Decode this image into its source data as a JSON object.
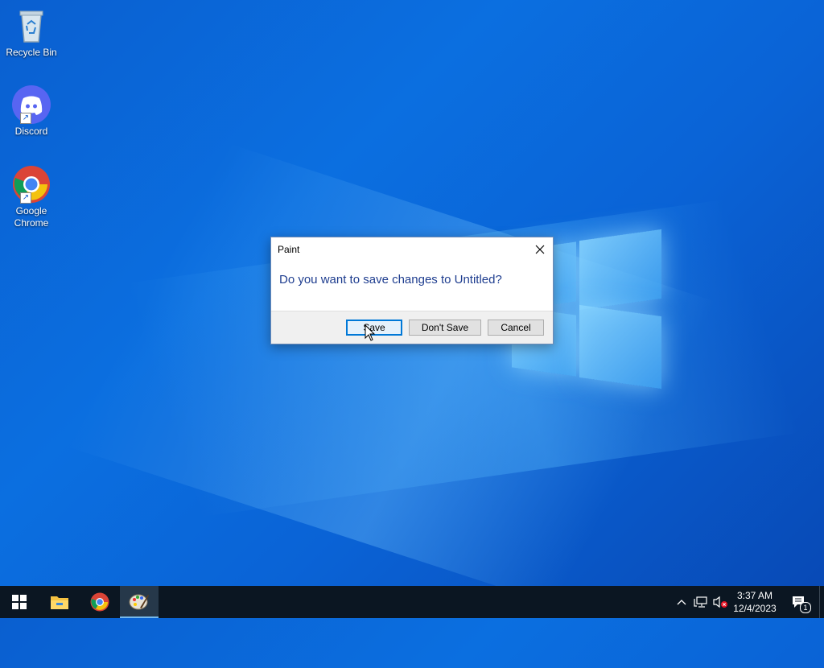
{
  "desktop": {
    "icons": [
      {
        "label": "Recycle Bin",
        "icon": "recycle-bin-icon"
      },
      {
        "label": "Discord",
        "icon": "discord-icon"
      },
      {
        "label": "Google Chrome",
        "icon": "chrome-icon"
      }
    ]
  },
  "dialog": {
    "title": "Paint",
    "message": "Do you want to save changes to Untitled?",
    "buttons": {
      "save": "Save",
      "dont_save": "Don't Save",
      "cancel": "Cancel"
    }
  },
  "taskbar": {
    "items": [
      "start-icon",
      "file-explorer-icon",
      "chrome-icon",
      "paint-icon"
    ],
    "active_item": "paint-icon",
    "tray": {
      "time": "3:37 AM",
      "date": "12/4/2023",
      "notification_count": "1"
    }
  },
  "colors": {
    "accent": "#0078d7",
    "taskbar": "#0b1622",
    "dialog_message": "#1e3d8f"
  }
}
